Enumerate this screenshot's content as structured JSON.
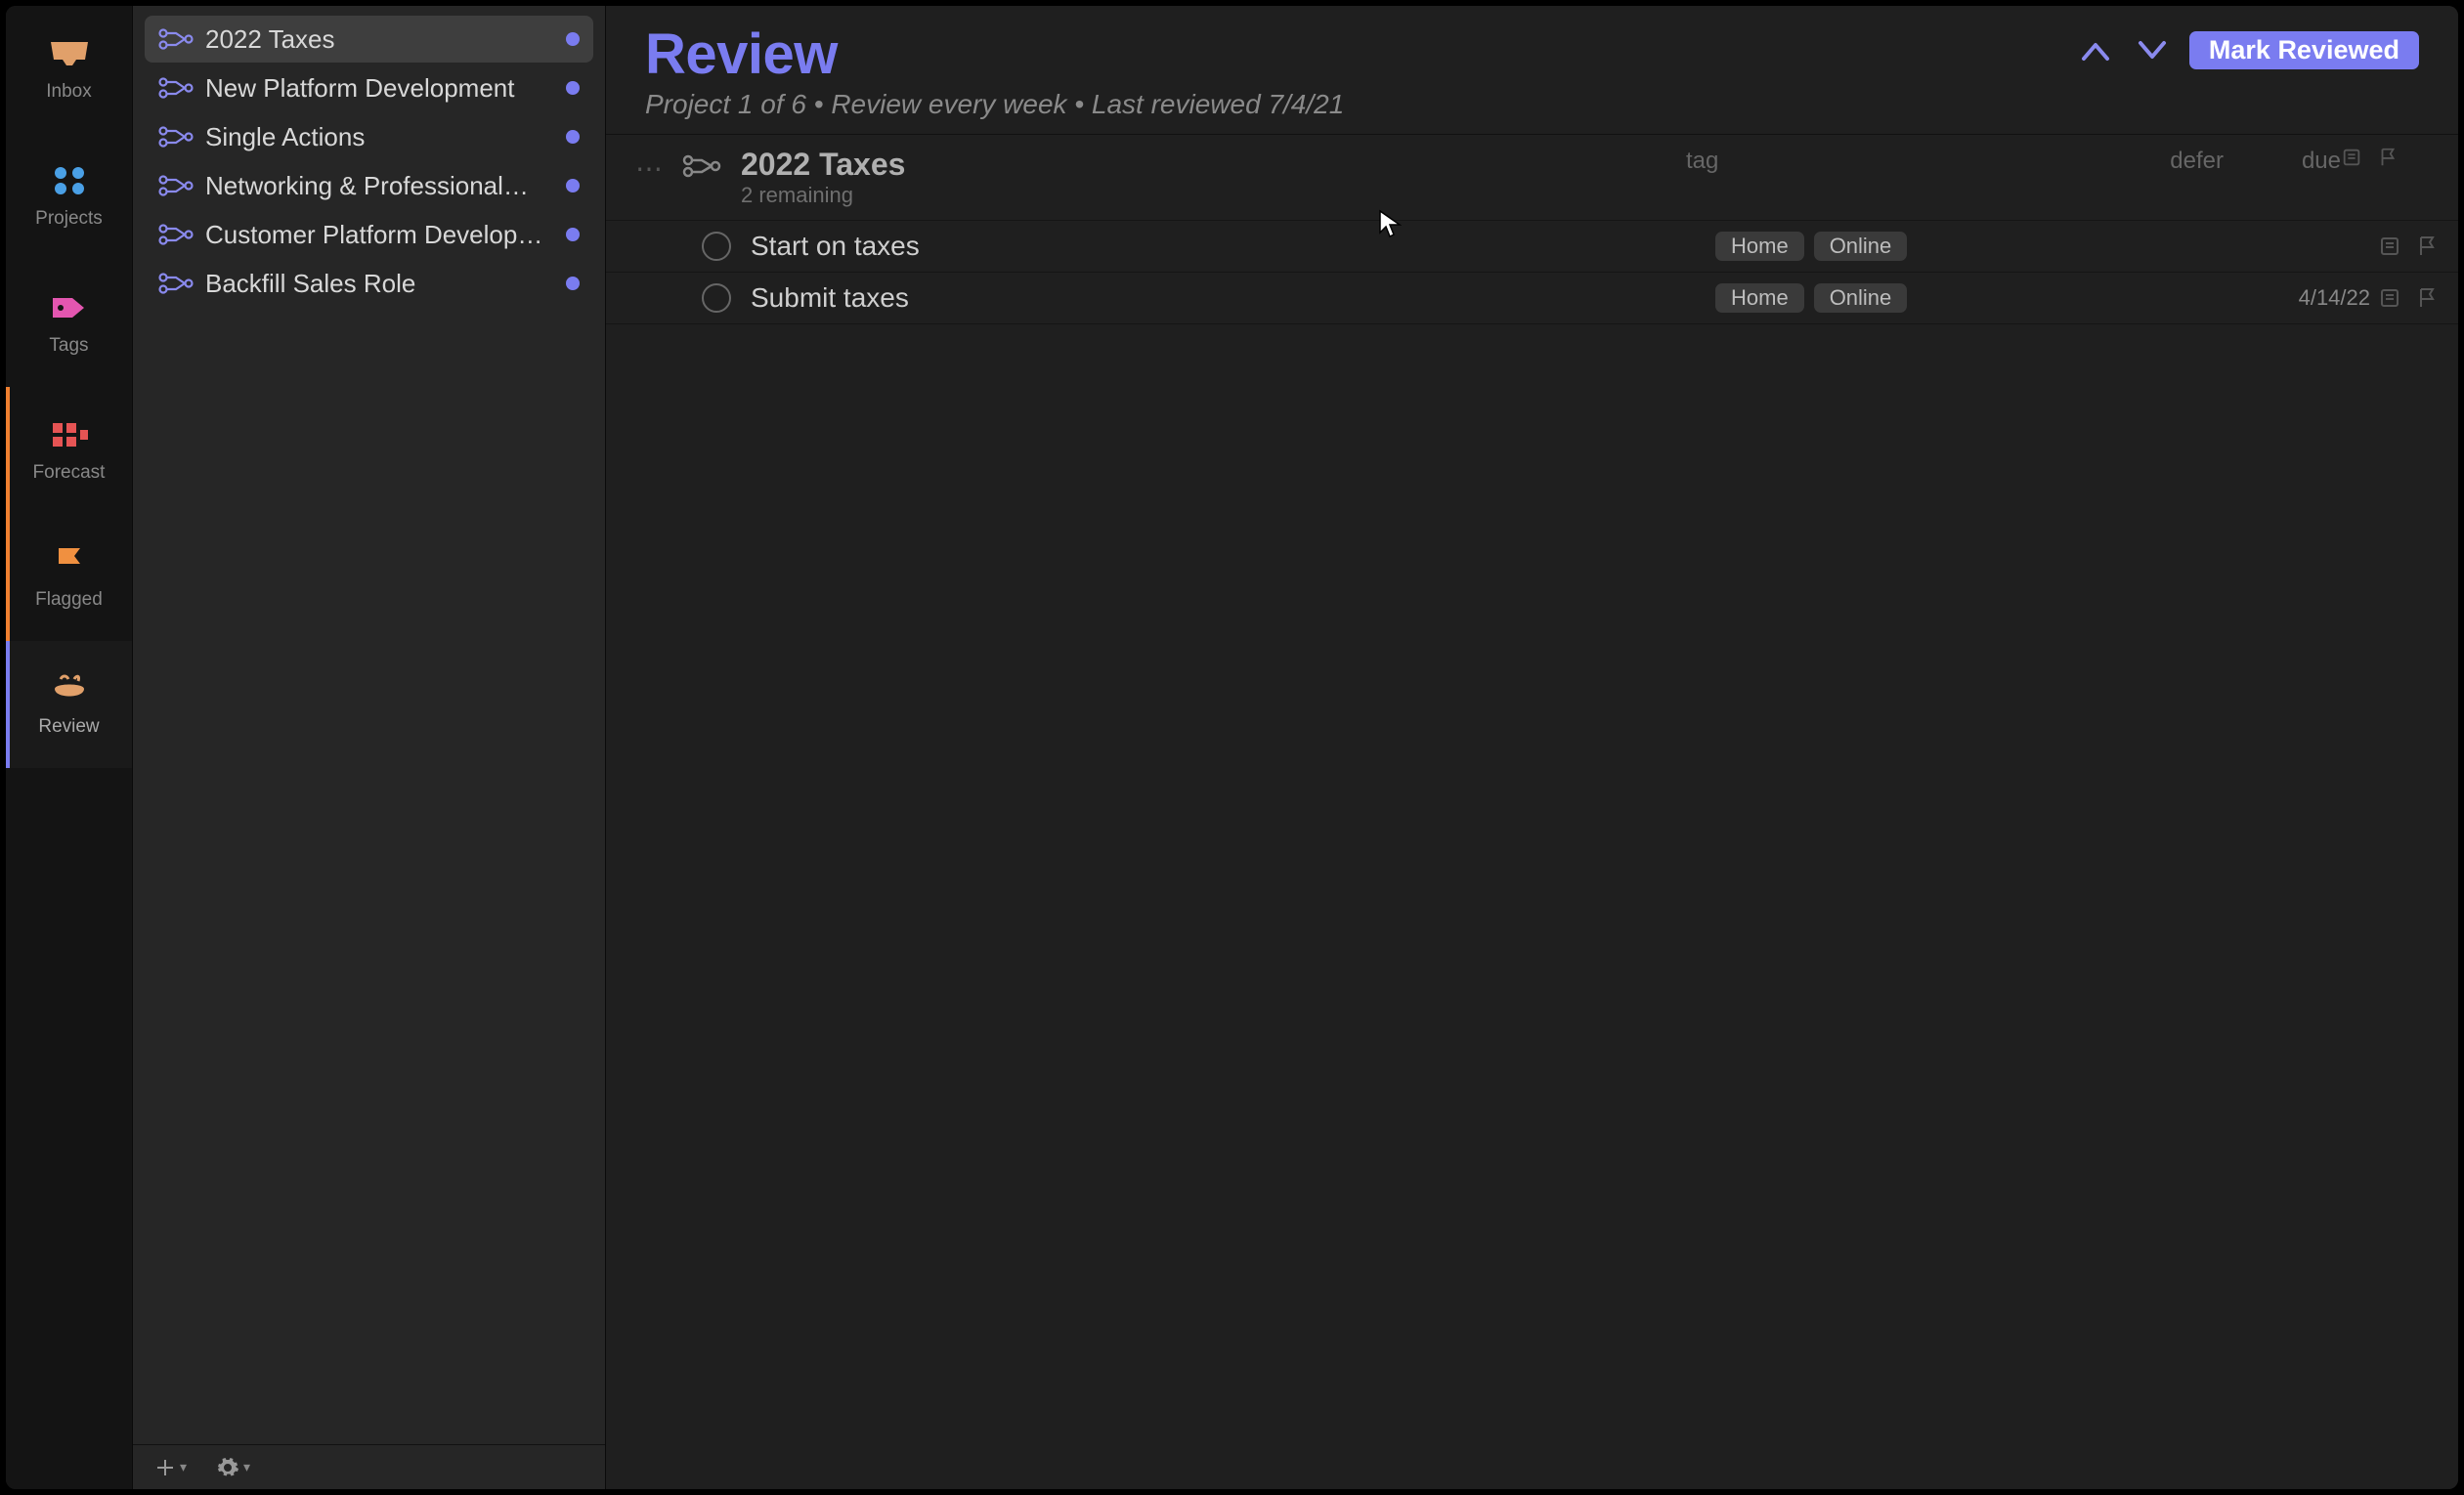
{
  "rail": [
    {
      "key": "inbox",
      "label": "Inbox"
    },
    {
      "key": "projects",
      "label": "Projects"
    },
    {
      "key": "tags",
      "label": "Tags"
    },
    {
      "key": "forecast",
      "label": "Forecast"
    },
    {
      "key": "flagged",
      "label": "Flagged"
    },
    {
      "key": "review",
      "label": "Review"
    }
  ],
  "sidebar": {
    "items": [
      {
        "label": "2022 Taxes",
        "selected": true
      },
      {
        "label": "New Platform Development",
        "selected": false
      },
      {
        "label": "Single Actions",
        "selected": false
      },
      {
        "label": "Networking & Professional…",
        "selected": false
      },
      {
        "label": "Customer Platform Develop…",
        "selected": false
      },
      {
        "label": "Backfill Sales Role",
        "selected": false
      }
    ]
  },
  "header": {
    "title": "Review",
    "subtitle": "Project 1 of 6 • Review every week • Last reviewed 7/4/21",
    "mark_label": "Mark Reviewed"
  },
  "columns": {
    "tag": "tag",
    "defer": "defer",
    "due": "due"
  },
  "project": {
    "title": "2022 Taxes",
    "subtitle": "2 remaining"
  },
  "tasks": [
    {
      "name": "Start on taxes",
      "tags": [
        "Home",
        "Online"
      ],
      "defer": "",
      "due": ""
    },
    {
      "name": "Submit taxes",
      "tags": [
        "Home",
        "Online"
      ],
      "defer": "",
      "due": "4/14/22"
    }
  ]
}
